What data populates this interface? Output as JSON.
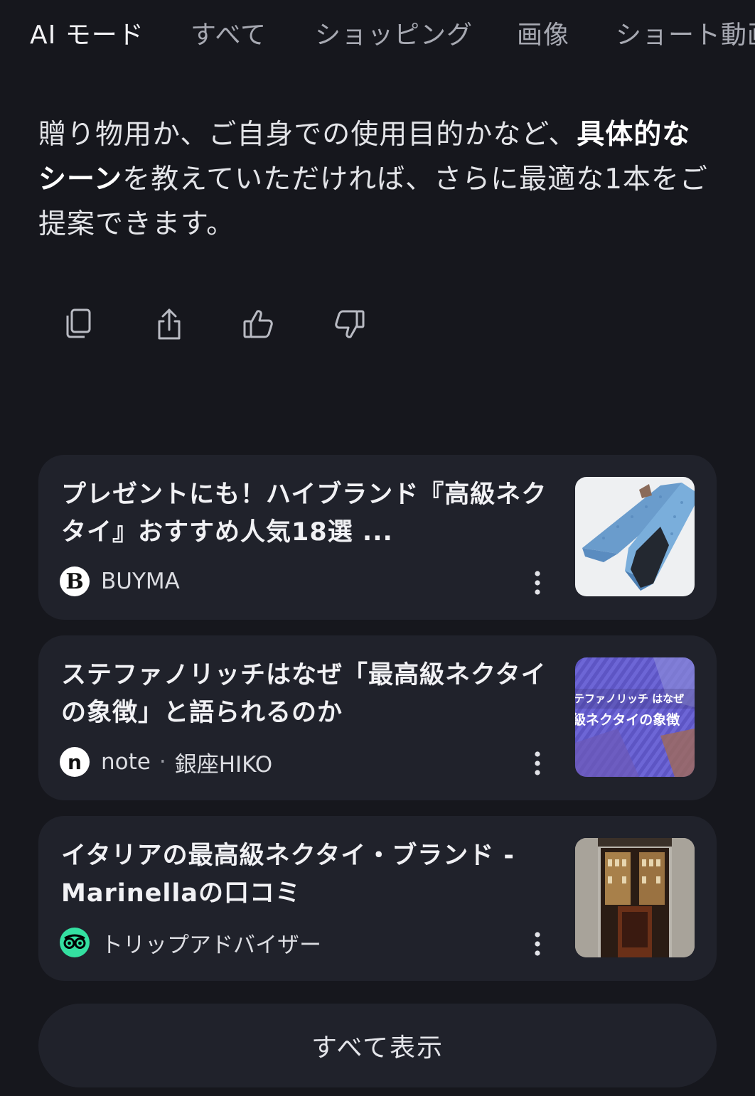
{
  "tabs": [
    {
      "label": "AI モード",
      "active": true
    },
    {
      "label": "すべて",
      "active": false
    },
    {
      "label": "ショッピング",
      "active": false
    },
    {
      "label": "画像",
      "active": false
    },
    {
      "label": "ショート動画",
      "active": false
    }
  ],
  "answer": {
    "part1": "贈り物用か、ご自身での使用目的かなど、",
    "bold": "具体的なシーン",
    "part2": "を教えていただければ、さらに最適な1本をご提案できます。"
  },
  "actions": [
    {
      "icon": "copy-icon"
    },
    {
      "icon": "share-icon"
    },
    {
      "icon": "thumbs-up-icon"
    },
    {
      "icon": "thumbs-down-icon"
    }
  ],
  "sources": [
    {
      "title": "プレゼントにも！ハイブランド『高級ネクタイ』おすすめ人気18選 ...",
      "site": "BUYMA",
      "author": "",
      "favicon_letter": "B",
      "thumbnail": "blue-tie-photo"
    },
    {
      "title": "ステファノリッチはなぜ「最高級ネクタイの象徴」と語られるのか",
      "site": "note",
      "author": "銀座HIKO",
      "favicon_letter": "n",
      "thumbnail": "purple-tie-photo",
      "thumbnail_text_1": "テファノリッチ はなぜ",
      "thumbnail_text_2": "級ネクタイの象徴"
    },
    {
      "title": "イタリアの最高級ネクタイ・ブランド - Marinellaの口コミ",
      "site": "トリップアドバイザー",
      "author": "",
      "favicon_letter": "",
      "thumbnail": "shop-front-photo"
    }
  ],
  "show_all_label": "すべて表示"
}
